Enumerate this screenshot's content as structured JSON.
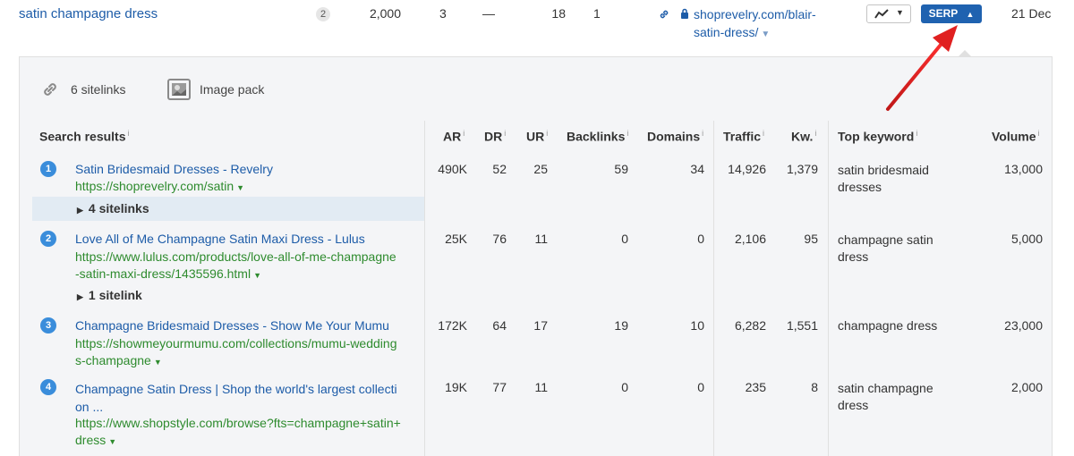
{
  "top_row": {
    "keyword": "satin champagne dress",
    "position": "2",
    "volume": "2,000",
    "kd": "3",
    "cpc": "—",
    "clicks": "18",
    "rr": "1",
    "url_line1": "shoprevelry.com/blair-",
    "url_line2": "satin-dress/",
    "serp_label": "SERP",
    "date": "21 Dec"
  },
  "tabs": [
    {
      "label": "6 sitelinks",
      "icon": "link-icon"
    },
    {
      "label": "Image pack",
      "icon": "image-icon"
    }
  ],
  "columns": {
    "search_results": "Search results",
    "ar": "AR",
    "dr": "DR",
    "ur": "UR",
    "backlinks": "Backlinks",
    "domains": "Domains",
    "traffic": "Traffic",
    "kw": "Kw.",
    "top_keyword": "Top keyword",
    "volume": "Volume",
    "info_mark": "i"
  },
  "results": [
    {
      "rank": "1",
      "title": "Satin Bridesmaid Dresses - Revelry",
      "url_lines": [
        "https://shoprevelry.com/satin"
      ],
      "sitelinks": "4 sitelinks",
      "ar": "490K",
      "dr": "52",
      "ur": "25",
      "backlinks": "59",
      "domains": "34",
      "traffic": "14,926",
      "kw": "1,379",
      "top_keyword_lines": [
        "satin bridesmaid",
        "dresses"
      ],
      "volume": "13,000"
    },
    {
      "rank": "2",
      "title": "Love All of Me Champagne Satin Maxi Dress - Lulus",
      "url_lines": [
        "https://www.lulus.com/products/love-all-of-me-champagne",
        "-satin-maxi-dress/1435596.html"
      ],
      "sitelinks": "1 sitelink",
      "ar": "25K",
      "dr": "76",
      "ur": "11",
      "backlinks": "0",
      "domains": "0",
      "traffic": "2,106",
      "kw": "95",
      "top_keyword_lines": [
        "champagne satin",
        "dress"
      ],
      "volume": "5,000"
    },
    {
      "rank": "3",
      "title": "Champagne Bridesmaid Dresses - Show Me Your Mumu",
      "url_lines": [
        "https://showmeyourmumu.com/collections/mumu-wedding",
        "s-champagne"
      ],
      "ar": "172K",
      "dr": "64",
      "ur": "17",
      "backlinks": "19",
      "domains": "10",
      "traffic": "6,282",
      "kw": "1,551",
      "top_keyword_lines": [
        "champagne dress"
      ],
      "volume": "23,000"
    },
    {
      "rank": "4",
      "title_lines": [
        "Champagne Satin Dress | Shop the world's largest collecti",
        "on ..."
      ],
      "url_lines": [
        "https://www.shopstyle.com/browse?fts=champagne+satin+",
        "dress"
      ],
      "ar": "19K",
      "dr": "77",
      "ur": "11",
      "backlinks": "0",
      "domains": "0",
      "traffic": "235",
      "kw": "8",
      "top_keyword_lines": [
        "satin champagne",
        "dress"
      ],
      "volume": "2,000"
    }
  ],
  "colors": {
    "link": "#1d5ca8",
    "url": "#2e8b2e",
    "badge": "#3a8ddb",
    "serp_button": "#1f62b0",
    "arrow": "#e02020"
  }
}
